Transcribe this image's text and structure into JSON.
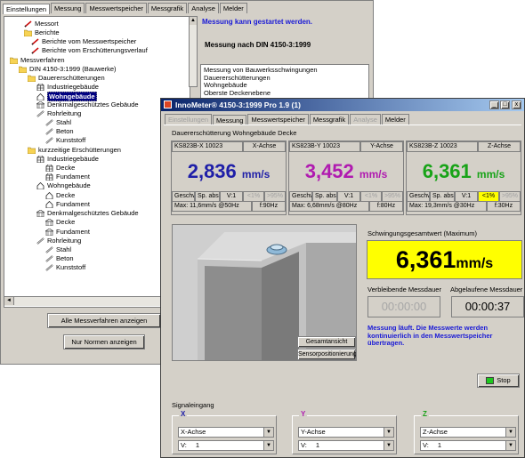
{
  "back_window": {
    "tabs": [
      "Einstellungen",
      "Messung",
      "Messwertspeicher",
      "Messgrafik",
      "Analyse",
      "Melder"
    ],
    "tree": [
      {
        "label": "Messort",
        "icon": "pen-icon"
      },
      {
        "label": "Berichte",
        "icon": "folder-icon"
      },
      {
        "label": "Berichte vom Messwertspeicher",
        "icon": "pen-icon"
      },
      {
        "label": "Berichte vom Erschütterungsverlauf",
        "icon": "pen-icon"
      },
      {
        "label": "Messverfahren",
        "icon": "folder-icon"
      },
      {
        "label": "DIN 4150-3:1999 (Bauwerke)",
        "icon": "folder-icon"
      },
      {
        "label": "Dauererschütterungen",
        "icon": "folder-icon"
      },
      {
        "label": "Industriegebäude",
        "icon": "building-icon"
      },
      {
        "label": "Wohngebäude",
        "icon": "house-icon"
      },
      {
        "label": "Denkmalgeschütztes Gebäude",
        "icon": "monument-icon"
      },
      {
        "label": "Rohrleitung",
        "icon": "pipe-icon"
      },
      {
        "label": "Stahl",
        "icon": "pipe-icon"
      },
      {
        "label": "Beton",
        "icon": "pipe-icon"
      },
      {
        "label": "Kunststoff",
        "icon": "pipe-icon"
      },
      {
        "label": "kurzzeitige Erschütterungen",
        "icon": "folder-icon"
      },
      {
        "label": "Industriegebäude",
        "icon": "building-icon"
      },
      {
        "label": "Decke",
        "icon": "building-icon"
      },
      {
        "label": "Fundament",
        "icon": "building-icon"
      },
      {
        "label": "Wohngebäude",
        "icon": "house-icon"
      },
      {
        "label": "Decke",
        "icon": "house-icon"
      },
      {
        "label": "Fundament",
        "icon": "house-icon"
      },
      {
        "label": "Denkmalgeschütztes Gebäude",
        "icon": "monument-icon"
      },
      {
        "label": "Decke",
        "icon": "monument-icon"
      },
      {
        "label": "Fundament",
        "icon": "monument-icon"
      },
      {
        "label": "Rohrleitung",
        "icon": "pipe-icon"
      },
      {
        "label": "Stahl",
        "icon": "pipe-icon"
      },
      {
        "label": "Beton",
        "icon": "pipe-icon"
      },
      {
        "label": "Kunststoff",
        "icon": "pipe-icon"
      }
    ],
    "status_message": "Messung kann gestartet werden.",
    "din_heading": "Messung nach DIN 4150-3:1999",
    "info_lines": [
      "Messung von Bauwerksschwingungen",
      "Dauererschütterungen",
      "Wohngebäude",
      "Oberste Deckenebene"
    ],
    "btn_all": "Alle Messverfahren anzeigen",
    "btn_norms": "Nur Normen anzeigen"
  },
  "front_window": {
    "title": "InnoMeter® 4150-3:1999 Pro 1.9 (1)",
    "title_buttons": [
      "_",
      "□",
      "x"
    ],
    "tabs": [
      "Einstellungen",
      "Messung",
      "Messwertspeicher",
      "Messgrafik",
      "Analyse",
      "Melder"
    ],
    "subtitle": "Dauererschütterung Wohngebäude Decke",
    "axes": [
      {
        "sensor": "KS823B-X 10023",
        "axis": "X-Achse",
        "value": "2,836",
        "unit": "mm/s",
        "color": "#1f1fa8",
        "row2": [
          "Geschw",
          "Sp. abs",
          "V:1",
          "<1%",
          ">95%"
        ],
        "max": "Max: 11,6mm/s @50Hz",
        "freq": "f:90Hz",
        "low_highlight": false
      },
      {
        "sensor": "KS823B-Y 10023",
        "axis": "Y-Achse",
        "value": "3,452",
        "unit": "mm/s",
        "color": "#b01ab0",
        "row2": [
          "Geschw",
          "Sp. abs",
          "V:1",
          "<1%",
          ">95%"
        ],
        "max": "Max: 6,68mm/s @80Hz",
        "freq": "f:80Hz",
        "low_highlight": false
      },
      {
        "sensor": "KS823B-Z 10023",
        "axis": "Z-Achse",
        "value": "6,361",
        "unit": "mm/s",
        "color": "#18a318",
        "row2": [
          "Geschw",
          "Sp. abs",
          "V:1",
          "<1%",
          ">95%"
        ],
        "max": "Max: 19,3mm/s @30Hz",
        "freq": "f:30Hz",
        "low_highlight": true
      }
    ],
    "btn_gesamt": "Gesamtansicht",
    "btn_sensor": "Sensorpositionierung",
    "total_label": "Schwingungsgesamtwert (Maximum)",
    "total_value": "6,361",
    "total_unit": "mm/s",
    "remaining_label": "Verbleibende Messdauer",
    "elapsed_label": "Abgelaufene Messdauer",
    "remaining_value": "00:00:00",
    "elapsed_value": "00:00:37",
    "running_msg": "Messung läuft. Die Messwerte werden kontinuierlich in den Messwertspeicher übertragen.",
    "stop_label": "Stop",
    "signal_label": "Signaleingang",
    "inputs": [
      {
        "axis": "X",
        "color": "#1f1fa8",
        "select1": "X-Achse",
        "select2_prefix": "V:",
        "select2_value": "1"
      },
      {
        "axis": "Y",
        "color": "#b01ab0",
        "select1": "Y-Achse",
        "select2_prefix": "V:",
        "select2_value": "1"
      },
      {
        "axis": "Z",
        "color": "#18a318",
        "select1": "Z-Achse",
        "select2_prefix": "V:",
        "select2_value": "1"
      }
    ]
  }
}
